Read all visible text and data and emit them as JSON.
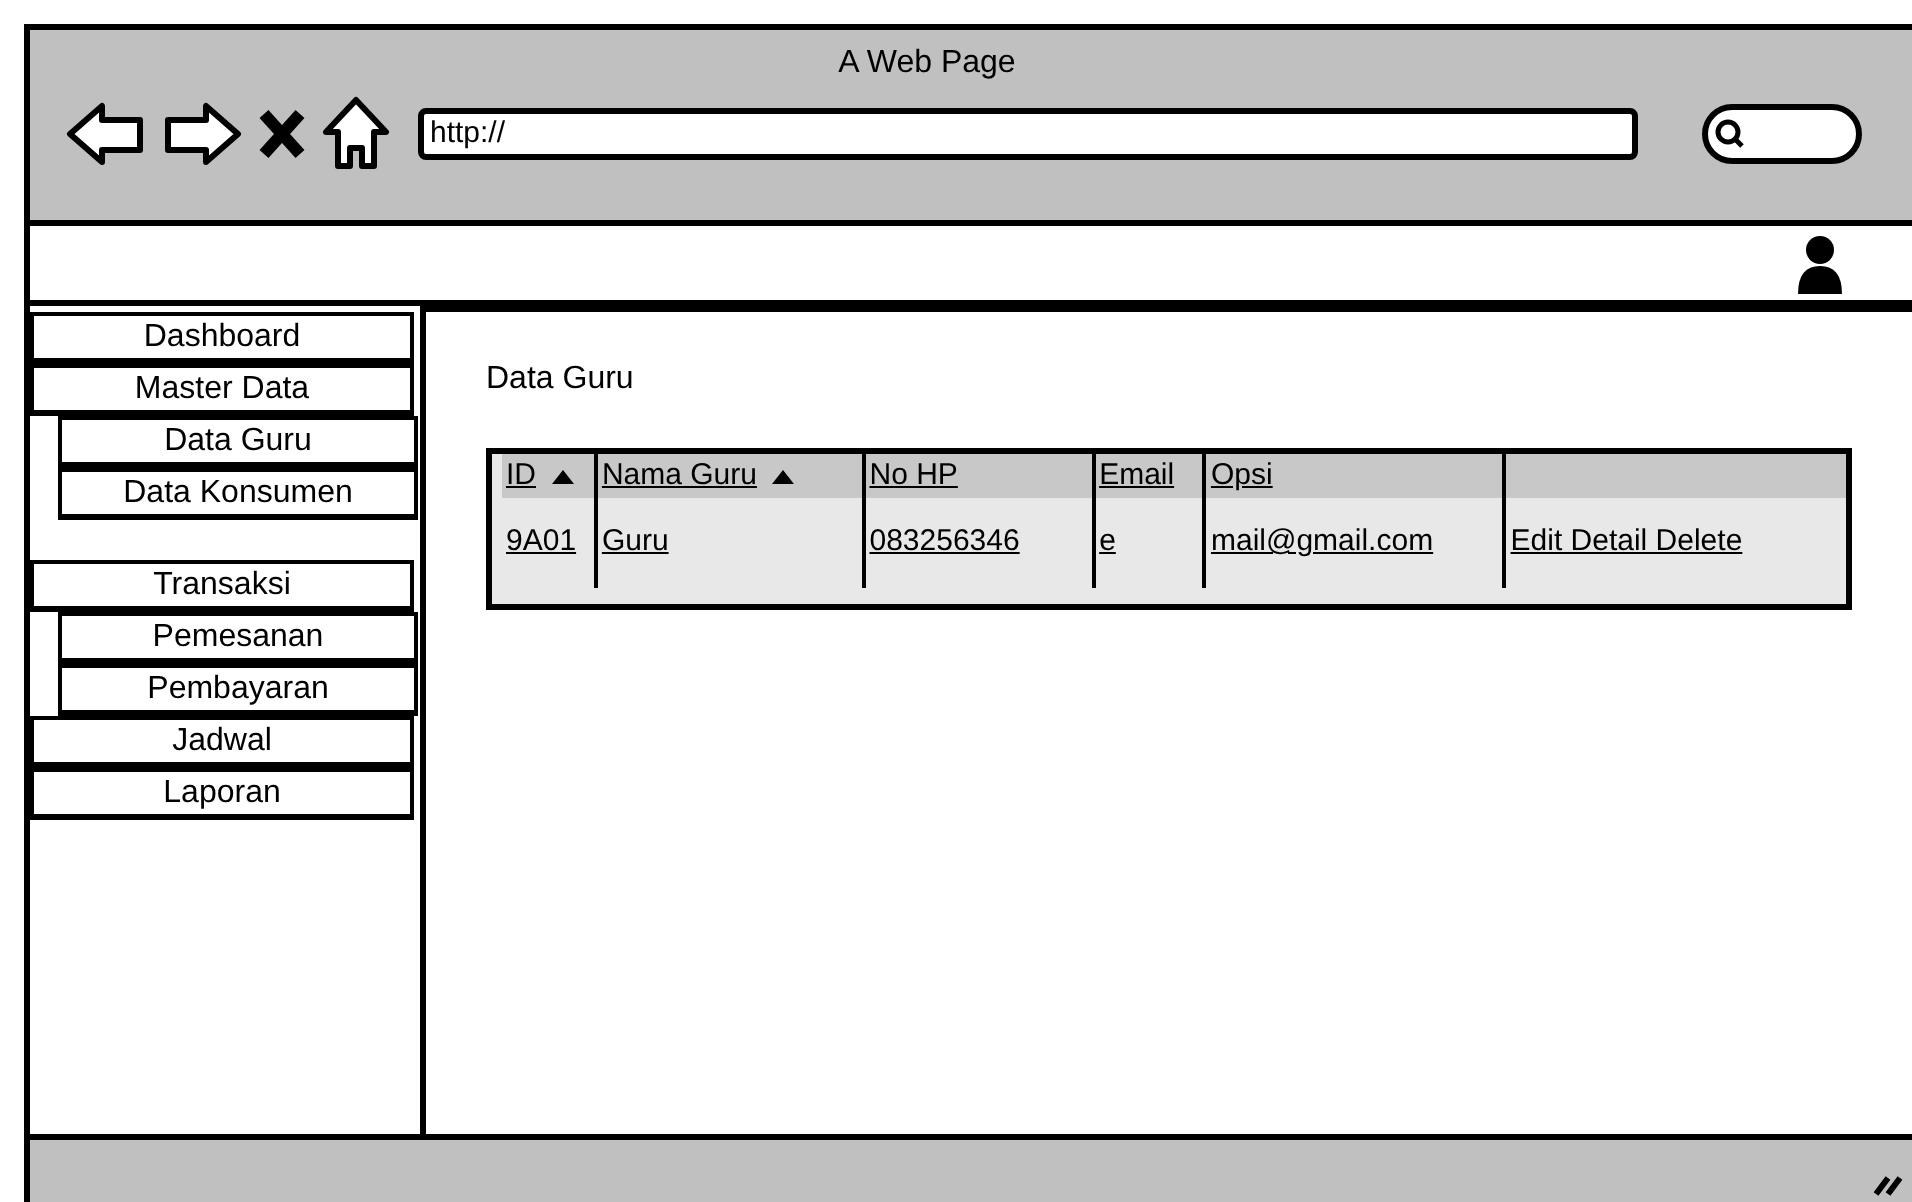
{
  "window": {
    "title": "A Web Page"
  },
  "address_bar": {
    "value": "http://"
  },
  "sidebar": {
    "groups": [
      {
        "items": [
          {
            "label": "Dashboard"
          },
          {
            "label": "Master Data",
            "children": [
              {
                "label": "Data Guru"
              },
              {
                "label": "Data Konsumen"
              }
            ]
          }
        ]
      },
      {
        "items": [
          {
            "label": "Transaksi",
            "children": [
              {
                "label": "Pemesanan"
              },
              {
                "label": "Pembayaran"
              }
            ]
          },
          {
            "label": "Jadwal"
          },
          {
            "label": "Laporan"
          }
        ]
      }
    ]
  },
  "content": {
    "title": "Data Guru",
    "table": {
      "columns": [
        {
          "label": "ID",
          "sorted": true
        },
        {
          "label": "Nama Guru",
          "sorted": true
        },
        {
          "label": "No HP",
          "sorted": false
        },
        {
          "label": "Email",
          "sorted": false
        },
        {
          "label": "Opsi",
          "sorted": false
        }
      ],
      "rows": [
        [
          "9A01",
          "Guru",
          "083256346",
          "e",
          "mail@gmail.com",
          "Edit Detail Delete"
        ]
      ]
    }
  }
}
